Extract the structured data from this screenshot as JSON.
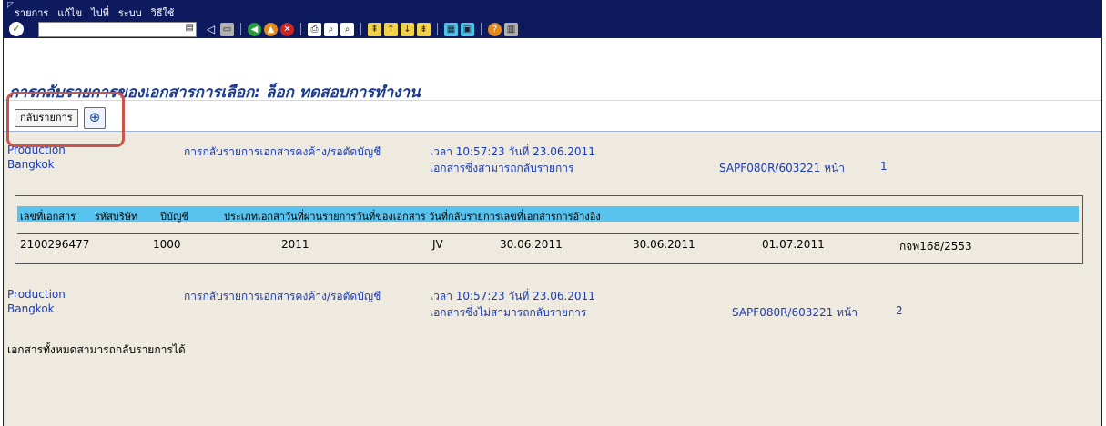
{
  "menu": {
    "items": [
      "รายการ",
      "แก้ไข",
      "ไปที่",
      "ระบบ",
      "วิธีใช้"
    ]
  },
  "toolbar": {
    "command_value": ""
  },
  "page": {
    "title": "การกลับรายการของเอกสารการเลือก: ล็อก ทดสอบการทำงาน"
  },
  "app_toolbar": {
    "reverse_button_label": "กลับรายการ"
  },
  "section1": {
    "line1_left": "Production",
    "line1_mid": "การกลับรายการเอกสารคงค้าง/รอตัดบัญชี",
    "time": "เวลา 10:57:23   วันที่ 23.06.2011",
    "line2_left": "Bangkok",
    "line2_mid": "เอกสารซึ่งสามารถกลับรายการ",
    "program": "SAPF080R/603221  หน้า",
    "page_no": "1"
  },
  "table": {
    "headers": [
      "เลขที่เอกสาร",
      "รหัสบริษัท",
      "ปีบัญชี",
      "ประเภทเอกสาวันที่ผ่านรายการวันที่ของเอกสาร วันที่กลับรายการเลขที่เอกสารการอ้างอิง"
    ],
    "rows": [
      [
        "2100296477",
        "1000",
        "2011",
        "JV",
        "30.06.2011",
        "30.06.2011",
        "01.07.2011",
        "กจพ168/2553"
      ]
    ]
  },
  "section2": {
    "line1_left": "Production",
    "line1_mid": "การกลับรายการเอกสารคงค้าง/รอตัดบัญชี",
    "time": "เวลา 10:57:23   วันที่ 23.06.2011",
    "line2_left": "Bangkok",
    "line2_mid": "เอกสารซึ่งไม่สามารถกลับรายการ",
    "program": "SAPF080R/603221  หน้า",
    "page_no": "2"
  },
  "message": "เอกสารทั้งหมดสามารถกลับรายการได้",
  "colors": {
    "header_band": "#0d1a5e",
    "table_header": "#58c3ef",
    "title": "#1b3a8c",
    "highlight": "#c9544a",
    "background": "#eeeae0"
  }
}
